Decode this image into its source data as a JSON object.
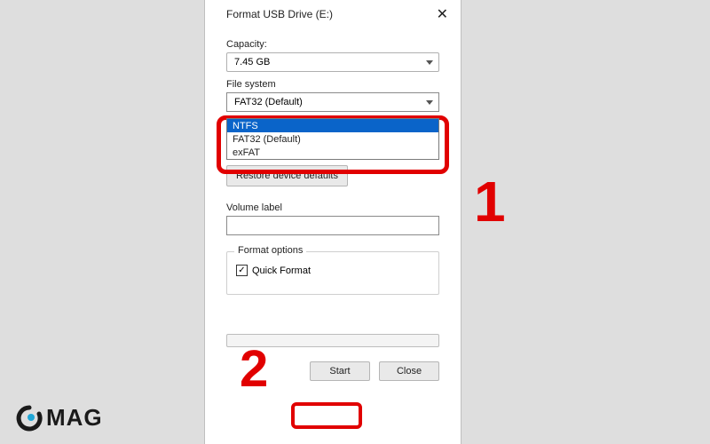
{
  "dialog": {
    "title": "Format USB Drive (E:)",
    "close_icon": "✕"
  },
  "capacity": {
    "label": "Capacity:",
    "value": "7.45 GB"
  },
  "filesystem": {
    "label": "File system",
    "selected": "FAT32 (Default)",
    "options": [
      "NTFS",
      "FAT32 (Default)",
      "exFAT"
    ],
    "highlighted_index": 0
  },
  "restore": {
    "label": "Restore device defaults"
  },
  "volume": {
    "label": "Volume label",
    "value": ""
  },
  "format_options": {
    "legend": "Format options",
    "quick_format_label": "Quick Format",
    "quick_format_checked": true
  },
  "buttons": {
    "start": "Start",
    "close": "Close"
  },
  "callouts": {
    "num1": "1",
    "num2": "2"
  },
  "logo": {
    "text": "MAG"
  }
}
